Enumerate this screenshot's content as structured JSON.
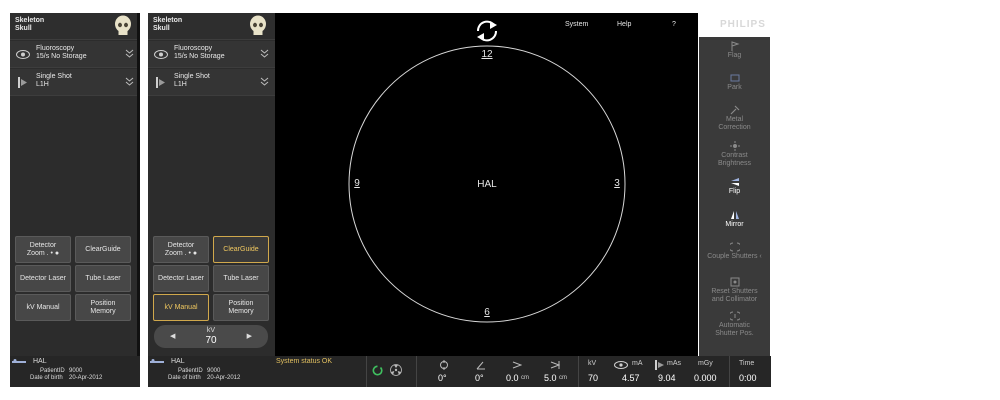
{
  "brand": "PHILIPS",
  "top_menu": {
    "system": "System",
    "help": "Help",
    "question": "?"
  },
  "left_panel": {
    "protocol_line1": "Skeleton",
    "protocol_line2": "Skull",
    "mode_line1": "Fluoroscopy",
    "mode_line2": "15/s  No Storage",
    "acq_line1": "Single Shot",
    "acq_line2": "L1H",
    "buttons": {
      "detector_zoom_line1": "Detector",
      "detector_zoom_line2": "Zoom  . • ●",
      "clearguide": "ClearGuide",
      "detector_laser": "Detector Laser",
      "tube_laser": "Tube Laser",
      "kv_manual": "kV Manual",
      "position_memory_line1": "Position",
      "position_memory_line2": "Memory"
    },
    "kv": {
      "label": "kV",
      "value": "70",
      "left_arrow": "◀",
      "right_arrow": "▶"
    }
  },
  "viewer": {
    "center_label": "HAL",
    "dial": {
      "top": "12",
      "right": "3",
      "bottom": "6",
      "left": "9"
    }
  },
  "right_panel": [
    {
      "line1": "Flag",
      "line2": "",
      "active": false,
      "icon": "flag-icon"
    },
    {
      "line1": "Park",
      "line2": "",
      "active": false,
      "icon": "park-icon"
    },
    {
      "line1": "Metal",
      "line2": "Correction",
      "active": false,
      "icon": "metal-correction-icon"
    },
    {
      "line1": "Contrast",
      "line2": "Brightness",
      "active": false,
      "icon": "contrast-icon"
    },
    {
      "line1": "Flip",
      "line2": "",
      "active": true,
      "icon": "flip-icon"
    },
    {
      "line1": "Mirror",
      "line2": "",
      "active": true,
      "icon": "mirror-icon"
    },
    {
      "line1": "Couple Shutters ‹",
      "line2": "",
      "active": false,
      "icon": "couple-shutters-icon"
    },
    {
      "line1": "Reset Shutters",
      "line2": "and Collimator",
      "active": false,
      "icon": "reset-shutters-icon"
    },
    {
      "line1": "Automatic",
      "line2": "Shutter Pos.",
      "active": false,
      "icon": "automatic-shutter-icon"
    }
  ],
  "status_bar": {
    "patient_name": "HAL",
    "patient_id_label": "PatientID",
    "patient_id": "9000",
    "dob_label": "Date of birth",
    "dob": "20-Apr-2012",
    "system_status": "System status OK",
    "angle1": "0°",
    "angle2": "0°",
    "dist1": "0.0",
    "dist1_unit": "cm",
    "dist2": "5.0",
    "dist2_unit": "cm",
    "kv_label": "kV",
    "kv_value": "70",
    "ma_label": "mA",
    "ma_value": "4.57",
    "mas_label": "mAs",
    "mas_value": "9.04",
    "mgy_label": "mGy",
    "mgy_value": "0.000",
    "time_label": "Time",
    "time_value": "0:00"
  },
  "colors": {
    "accent": "#d0a84c",
    "background": "#000000",
    "panel": "#2c2c2c",
    "ok_green": "#3fbf5f"
  }
}
